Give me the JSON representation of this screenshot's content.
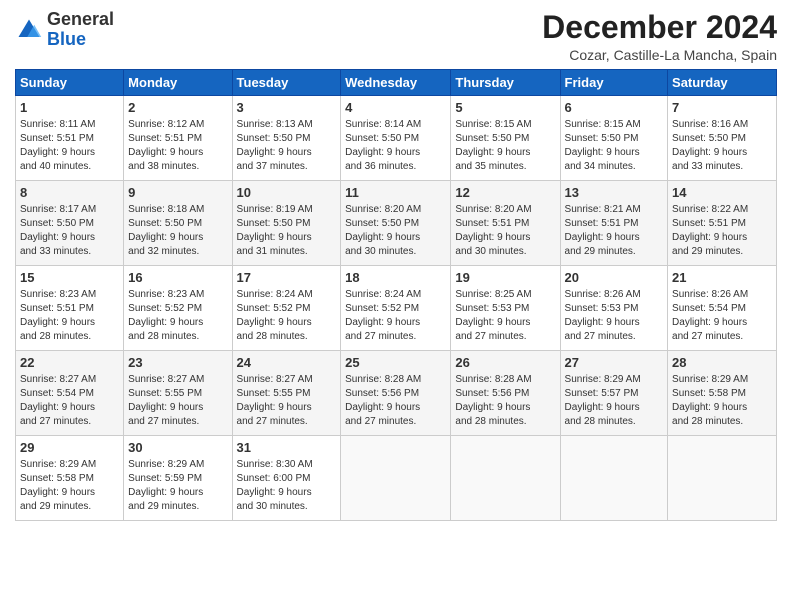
{
  "logo": {
    "general": "General",
    "blue": "Blue"
  },
  "title": "December 2024",
  "subtitle": "Cozar, Castille-La Mancha, Spain",
  "days_header": [
    "Sunday",
    "Monday",
    "Tuesday",
    "Wednesday",
    "Thursday",
    "Friday",
    "Saturday"
  ],
  "weeks": [
    [
      {
        "num": "1",
        "info": "Sunrise: 8:11 AM\nSunset: 5:51 PM\nDaylight: 9 hours\nand 40 minutes."
      },
      {
        "num": "2",
        "info": "Sunrise: 8:12 AM\nSunset: 5:51 PM\nDaylight: 9 hours\nand 38 minutes."
      },
      {
        "num": "3",
        "info": "Sunrise: 8:13 AM\nSunset: 5:50 PM\nDaylight: 9 hours\nand 37 minutes."
      },
      {
        "num": "4",
        "info": "Sunrise: 8:14 AM\nSunset: 5:50 PM\nDaylight: 9 hours\nand 36 minutes."
      },
      {
        "num": "5",
        "info": "Sunrise: 8:15 AM\nSunset: 5:50 PM\nDaylight: 9 hours\nand 35 minutes."
      },
      {
        "num": "6",
        "info": "Sunrise: 8:15 AM\nSunset: 5:50 PM\nDaylight: 9 hours\nand 34 minutes."
      },
      {
        "num": "7",
        "info": "Sunrise: 8:16 AM\nSunset: 5:50 PM\nDaylight: 9 hours\nand 33 minutes."
      }
    ],
    [
      {
        "num": "8",
        "info": "Sunrise: 8:17 AM\nSunset: 5:50 PM\nDaylight: 9 hours\nand 33 minutes."
      },
      {
        "num": "9",
        "info": "Sunrise: 8:18 AM\nSunset: 5:50 PM\nDaylight: 9 hours\nand 32 minutes."
      },
      {
        "num": "10",
        "info": "Sunrise: 8:19 AM\nSunset: 5:50 PM\nDaylight: 9 hours\nand 31 minutes."
      },
      {
        "num": "11",
        "info": "Sunrise: 8:20 AM\nSunset: 5:50 PM\nDaylight: 9 hours\nand 30 minutes."
      },
      {
        "num": "12",
        "info": "Sunrise: 8:20 AM\nSunset: 5:51 PM\nDaylight: 9 hours\nand 30 minutes."
      },
      {
        "num": "13",
        "info": "Sunrise: 8:21 AM\nSunset: 5:51 PM\nDaylight: 9 hours\nand 29 minutes."
      },
      {
        "num": "14",
        "info": "Sunrise: 8:22 AM\nSunset: 5:51 PM\nDaylight: 9 hours\nand 29 minutes."
      }
    ],
    [
      {
        "num": "15",
        "info": "Sunrise: 8:23 AM\nSunset: 5:51 PM\nDaylight: 9 hours\nand 28 minutes."
      },
      {
        "num": "16",
        "info": "Sunrise: 8:23 AM\nSunset: 5:52 PM\nDaylight: 9 hours\nand 28 minutes."
      },
      {
        "num": "17",
        "info": "Sunrise: 8:24 AM\nSunset: 5:52 PM\nDaylight: 9 hours\nand 28 minutes."
      },
      {
        "num": "18",
        "info": "Sunrise: 8:24 AM\nSunset: 5:52 PM\nDaylight: 9 hours\nand 27 minutes."
      },
      {
        "num": "19",
        "info": "Sunrise: 8:25 AM\nSunset: 5:53 PM\nDaylight: 9 hours\nand 27 minutes."
      },
      {
        "num": "20",
        "info": "Sunrise: 8:26 AM\nSunset: 5:53 PM\nDaylight: 9 hours\nand 27 minutes."
      },
      {
        "num": "21",
        "info": "Sunrise: 8:26 AM\nSunset: 5:54 PM\nDaylight: 9 hours\nand 27 minutes."
      }
    ],
    [
      {
        "num": "22",
        "info": "Sunrise: 8:27 AM\nSunset: 5:54 PM\nDaylight: 9 hours\nand 27 minutes."
      },
      {
        "num": "23",
        "info": "Sunrise: 8:27 AM\nSunset: 5:55 PM\nDaylight: 9 hours\nand 27 minutes."
      },
      {
        "num": "24",
        "info": "Sunrise: 8:27 AM\nSunset: 5:55 PM\nDaylight: 9 hours\nand 27 minutes."
      },
      {
        "num": "25",
        "info": "Sunrise: 8:28 AM\nSunset: 5:56 PM\nDaylight: 9 hours\nand 27 minutes."
      },
      {
        "num": "26",
        "info": "Sunrise: 8:28 AM\nSunset: 5:56 PM\nDaylight: 9 hours\nand 28 minutes."
      },
      {
        "num": "27",
        "info": "Sunrise: 8:29 AM\nSunset: 5:57 PM\nDaylight: 9 hours\nand 28 minutes."
      },
      {
        "num": "28",
        "info": "Sunrise: 8:29 AM\nSunset: 5:58 PM\nDaylight: 9 hours\nand 28 minutes."
      }
    ],
    [
      {
        "num": "29",
        "info": "Sunrise: 8:29 AM\nSunset: 5:58 PM\nDaylight: 9 hours\nand 29 minutes."
      },
      {
        "num": "30",
        "info": "Sunrise: 8:29 AM\nSunset: 5:59 PM\nDaylight: 9 hours\nand 29 minutes."
      },
      {
        "num": "31",
        "info": "Sunrise: 8:30 AM\nSunset: 6:00 PM\nDaylight: 9 hours\nand 30 minutes."
      },
      {
        "num": "",
        "info": ""
      },
      {
        "num": "",
        "info": ""
      },
      {
        "num": "",
        "info": ""
      },
      {
        "num": "",
        "info": ""
      }
    ]
  ]
}
